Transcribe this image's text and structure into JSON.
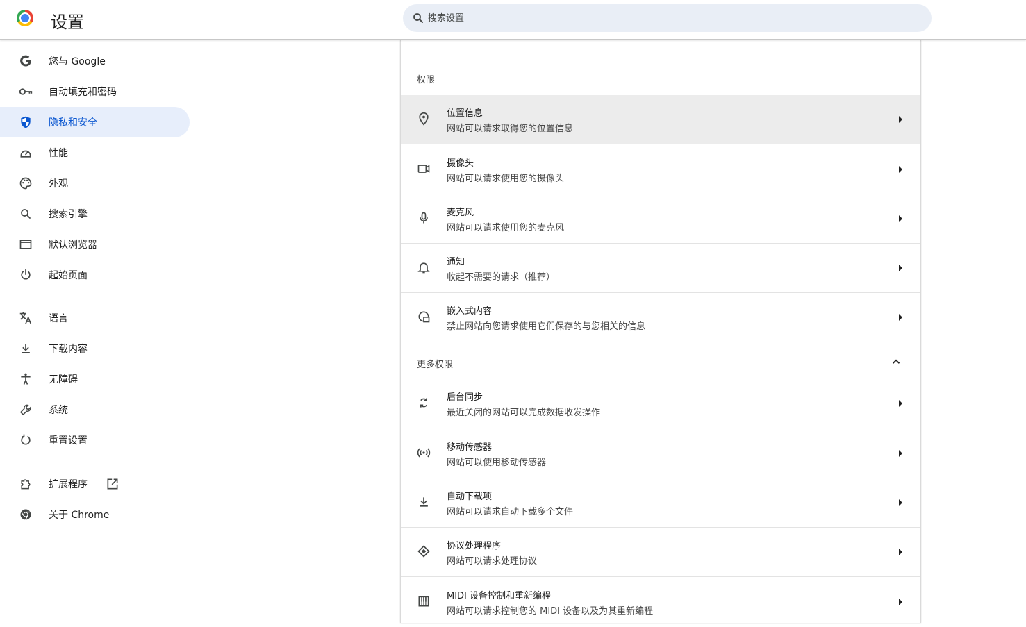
{
  "header": {
    "title": "设置",
    "search_placeholder": "搜索设置"
  },
  "sidebar": {
    "group1": [
      {
        "label": "您与 Google",
        "icon": "google-g-icon"
      },
      {
        "label": "自动填充和密码",
        "icon": "key-icon"
      },
      {
        "label": "隐私和安全",
        "icon": "shield-icon",
        "active": true
      },
      {
        "label": "性能",
        "icon": "speedometer-icon"
      },
      {
        "label": "外观",
        "icon": "palette-icon"
      },
      {
        "label": "搜索引擎",
        "icon": "search-icon"
      },
      {
        "label": "默认浏览器",
        "icon": "browser-window-icon"
      },
      {
        "label": "起始页面",
        "icon": "power-icon"
      }
    ],
    "group2": [
      {
        "label": "语言",
        "icon": "translate-icon"
      },
      {
        "label": "下载内容",
        "icon": "download-icon"
      },
      {
        "label": "无障碍",
        "icon": "accessibility-icon"
      },
      {
        "label": "系统",
        "icon": "wrench-icon"
      },
      {
        "label": "重置设置",
        "icon": "reset-icon"
      }
    ],
    "group3": [
      {
        "label": "扩展程序",
        "icon": "puzzle-icon",
        "external_icon": "open-in-new-icon"
      },
      {
        "label": "关于 Chrome",
        "icon": "chrome-icon"
      }
    ]
  },
  "permissions": {
    "section_title": "权限",
    "items": [
      {
        "title": "位置信息",
        "subtitle": "网站可以请求取得您的位置信息",
        "icon": "location-pin-icon"
      },
      {
        "title": "摄像头",
        "subtitle": "网站可以请求使用您的摄像头",
        "icon": "camera-icon"
      },
      {
        "title": "麦克风",
        "subtitle": "网站可以请求使用您的麦克风",
        "icon": "microphone-icon"
      },
      {
        "title": "通知",
        "subtitle": "收起不需要的请求（推荐）",
        "icon": "bell-icon"
      },
      {
        "title": "嵌入式内容",
        "subtitle": "禁止网站向您请求使用它们保存的与您相关的信息",
        "icon": "embedded-content-icon"
      }
    ],
    "more_title": "更多权限",
    "more_items": [
      {
        "title": "后台同步",
        "subtitle": "最近关闭的网站可以完成数据收发操作",
        "icon": "sync-icon"
      },
      {
        "title": "移动传感器",
        "subtitle": "网站可以使用移动传感器",
        "icon": "sensor-icon"
      },
      {
        "title": "自动下载项",
        "subtitle": "网站可以请求自动下载多个文件",
        "icon": "download-icon"
      },
      {
        "title": "协议处理程序",
        "subtitle": "网站可以请求处理协议",
        "icon": "protocol-handler-icon"
      },
      {
        "title": "MIDI 设备控制和重新编程",
        "subtitle": "网站可以请求控制您的 MIDI 设备以及为其重新编程",
        "icon": "piano-icon"
      }
    ]
  },
  "colors": {
    "accent": "#0b57d0",
    "active_bg": "#e7eefb",
    "search_bg": "#e9eef6",
    "hover_row": "#ececec"
  }
}
